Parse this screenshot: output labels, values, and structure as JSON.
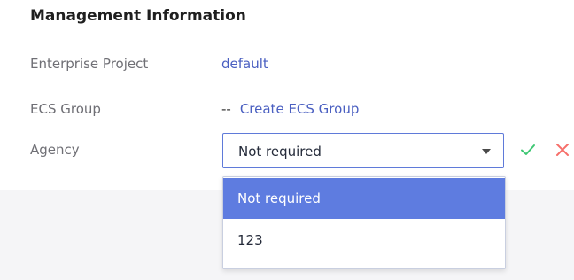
{
  "section": {
    "title": "Management Information"
  },
  "rows": {
    "enterprise_project": {
      "label": "Enterprise Project",
      "value": "default"
    },
    "ecs_group": {
      "label": "ECS Group",
      "prefix": "--",
      "link": "Create ECS Group"
    },
    "agency": {
      "label": "Agency",
      "selected": "Not required"
    }
  },
  "dropdown": {
    "options": [
      "Not required",
      "123"
    ]
  },
  "icons": {
    "confirm": "checkmark-icon",
    "cancel": "close-icon"
  },
  "colors": {
    "accent": "#5e7ce0",
    "link": "#4a5fc1",
    "confirm": "#3fc774",
    "cancel": "#f66f6a",
    "page_background": "#f5f5f7"
  }
}
